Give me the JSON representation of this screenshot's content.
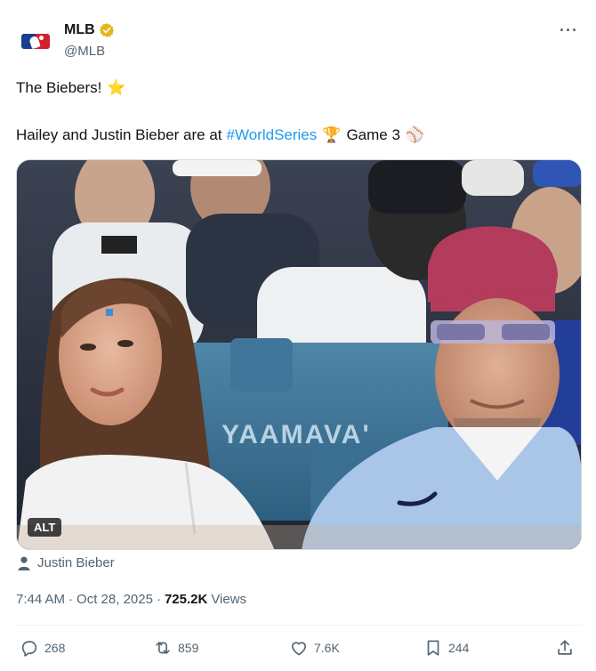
{
  "author": {
    "display_name": "MLB",
    "handle": "@MLB",
    "verified": true,
    "avatar_icon": "mlb-logo",
    "badge_color": "#e2b719"
  },
  "more_label": "···",
  "tweet": {
    "line1": "The Biebers!",
    "line1_emoji": "⭐",
    "line2_text": "Hailey and Justin Bieber are at",
    "line2_hashtag": "#WorldSeries",
    "line2_emoji": "🏆",
    "line2_suffix": "Game 3",
    "line2_end_emoji": "⚾"
  },
  "media": {
    "alt_badge": "ALT",
    "signage_text": "YAAMAVA'"
  },
  "tagged_person": "Justin Bieber",
  "meta": {
    "time": "7:44 AM",
    "date": "Oct 28, 2025",
    "views_count": "725.2K",
    "views_label": "Views"
  },
  "actions": {
    "replies": "268",
    "reposts": "859",
    "likes": "7.6K",
    "bookmarks": "244"
  },
  "colors": {
    "link": "#1d9bf0",
    "secondary_text": "#536471",
    "primary_text": "#0f1419"
  }
}
